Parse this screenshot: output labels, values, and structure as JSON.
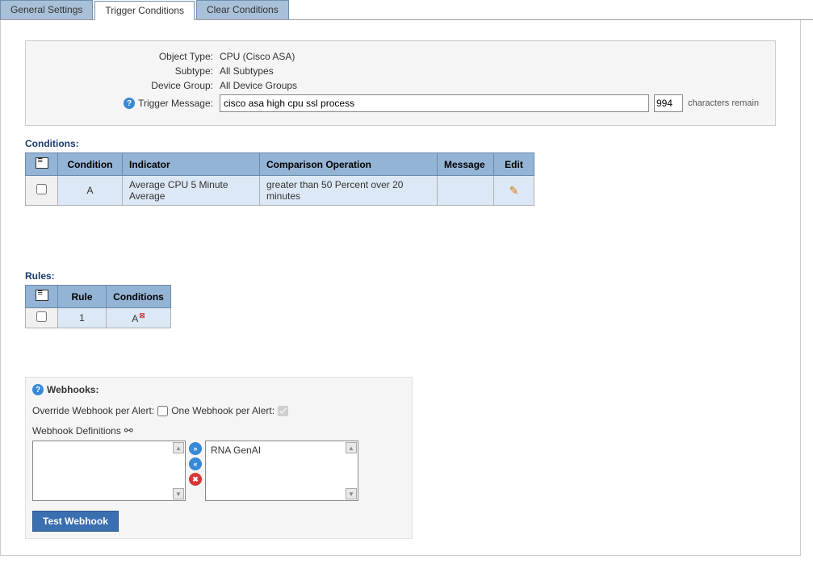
{
  "tabs": {
    "general": "General Settings",
    "trigger": "Trigger Conditions",
    "clear": "Clear Conditions"
  },
  "info": {
    "object_type_label": "Object Type:",
    "object_type_value": "CPU (Cisco ASA)",
    "subtype_label": "Subtype:",
    "subtype_value": "All Subtypes",
    "device_group_label": "Device Group:",
    "device_group_value": "All Device Groups",
    "trigger_message_label": "Trigger Message:",
    "trigger_message_value": "cisco asa high cpu ssl process",
    "chars_count": "994",
    "chars_remain": "characters remain"
  },
  "conditions": {
    "title": "Conditions:",
    "headers": {
      "condition": "Condition",
      "indicator": "Indicator",
      "comparison": "Comparison Operation",
      "message": "Message",
      "edit": "Edit"
    },
    "rows": [
      {
        "condition": "A",
        "indicator": "Average CPU 5 Minute Average",
        "comparison": "greater than 50 Percent over 20 minutes",
        "message": ""
      }
    ]
  },
  "rules": {
    "title": "Rules:",
    "headers": {
      "rule": "Rule",
      "conditions": "Conditions"
    },
    "rows": [
      {
        "rule": "1",
        "conditions": "A"
      }
    ]
  },
  "webhooks": {
    "title": "Webhooks:",
    "override_label": "Override Webhook per Alert:",
    "one_per_alert_label": "One Webhook per Alert:",
    "definitions_label": "Webhook Definitions",
    "right_items": [
      "RNA GenAI"
    ],
    "test_button": "Test Webhook"
  }
}
